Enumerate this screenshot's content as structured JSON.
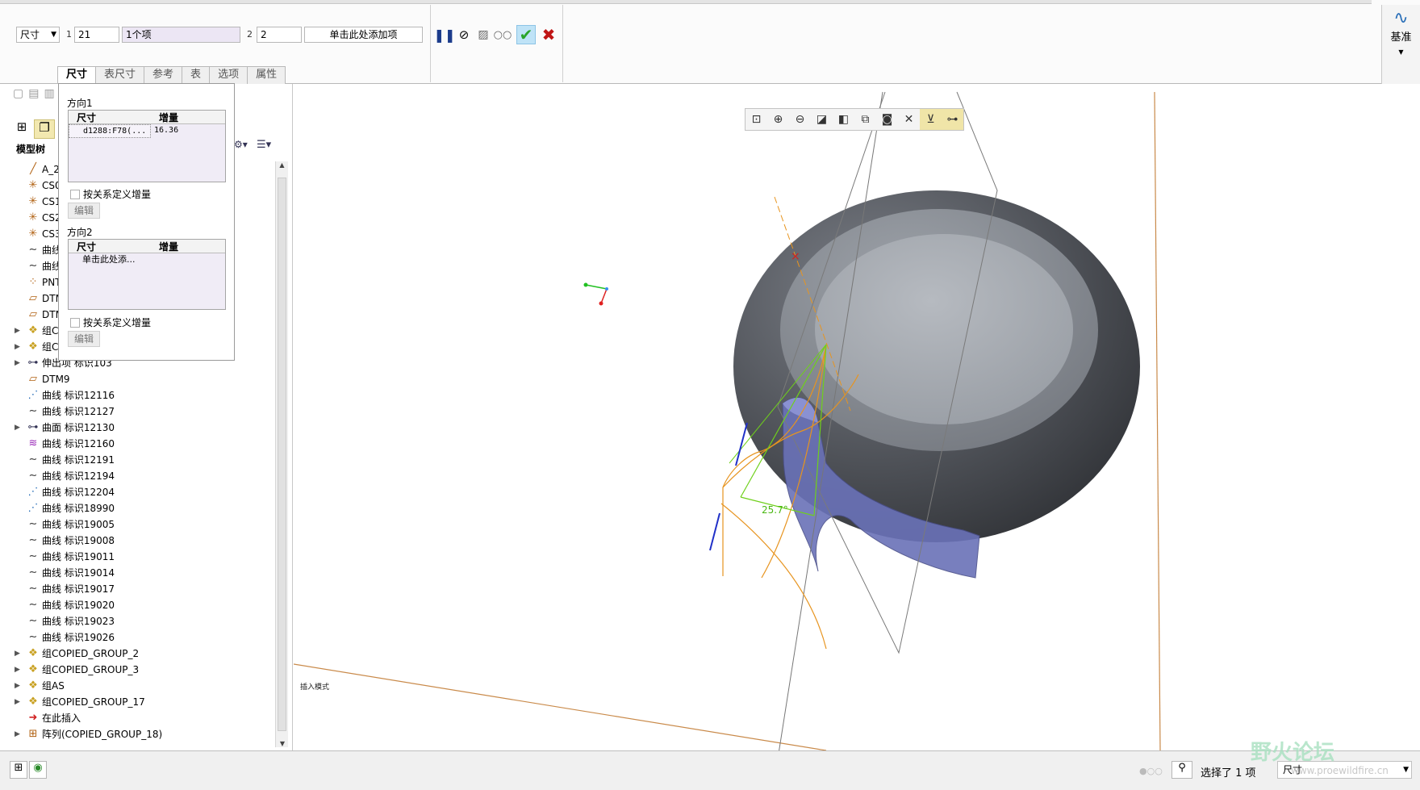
{
  "dashboard": {
    "type_select": "尺寸",
    "dir1_index": "1",
    "dir1_count": "21",
    "dir1_items": "1个项",
    "dir2_index": "2",
    "dir2_count": "2",
    "dir2_items": "单击此处添加项",
    "tabs": [
      "尺寸",
      "表尺寸",
      "参考",
      "表",
      "选项",
      "属性"
    ],
    "datum_label": "基准"
  },
  "dim_panel": {
    "dir1_label": "方向1",
    "dir2_label": "方向2",
    "col_dim": "尺寸",
    "col_inc": "增量",
    "dir1_row_dim": "d1288:F78(...",
    "dir1_row_inc": "16.36",
    "dir2_placeholder": "单击此处添...",
    "relation_check": "按关系定义增量",
    "edit_button": "编辑"
  },
  "tree": {
    "header_label": "模型树",
    "items": [
      {
        "label": "A_2",
        "icon": "axis-icon",
        "expand": false
      },
      {
        "label": "CS0",
        "icon": "csys-icon",
        "expand": false
      },
      {
        "label": "CS1",
        "icon": "csys-icon",
        "expand": false
      },
      {
        "label": "CS2",
        "icon": "csys-icon",
        "expand": false
      },
      {
        "label": "CS3",
        "icon": "csys-icon",
        "expand": false
      },
      {
        "label": "曲线",
        "icon": "curve-icon",
        "expand": false
      },
      {
        "label": "曲线",
        "icon": "curve-icon",
        "expand": false
      },
      {
        "label": "PNT",
        "icon": "point-icon",
        "expand": false
      },
      {
        "label": "DTM",
        "icon": "plane-icon",
        "expand": false
      },
      {
        "label": "DTM",
        "icon": "plane-icon",
        "expand": false
      },
      {
        "label": "组C",
        "icon": "group-icon",
        "expand": true
      },
      {
        "label": "组C",
        "icon": "group-icon",
        "expand": true
      },
      {
        "label": "伸出项 标识103",
        "icon": "protrusion-icon",
        "expand": true
      },
      {
        "label": "DTM9",
        "icon": "plane-icon",
        "expand": false
      },
      {
        "label": "曲线 标识12116",
        "icon": "curve-dotted-icon",
        "expand": false
      },
      {
        "label": "曲线 标识12127",
        "icon": "curve-icon",
        "expand": false
      },
      {
        "label": "曲面 标识12130",
        "icon": "surface-icon",
        "expand": true
      },
      {
        "label": "曲线 标识12160",
        "icon": "curve-purple-icon",
        "expand": false
      },
      {
        "label": "曲线 标识12191",
        "icon": "curve-icon",
        "expand": false
      },
      {
        "label": "曲线 标识12194",
        "icon": "curve-icon",
        "expand": false
      },
      {
        "label": "曲线 标识12204",
        "icon": "curve-dotted-icon",
        "expand": false
      },
      {
        "label": "曲线 标识18990",
        "icon": "curve-dotted-icon",
        "expand": false
      },
      {
        "label": "曲线 标识19005",
        "icon": "curve-icon",
        "expand": false
      },
      {
        "label": "曲线 标识19008",
        "icon": "curve-icon",
        "expand": false
      },
      {
        "label": "曲线 标识19011",
        "icon": "curve-icon",
        "expand": false
      },
      {
        "label": "曲线 标识19014",
        "icon": "curve-icon",
        "expand": false
      },
      {
        "label": "曲线 标识19017",
        "icon": "curve-icon",
        "expand": false
      },
      {
        "label": "曲线 标识19020",
        "icon": "curve-icon",
        "expand": false
      },
      {
        "label": "曲线 标识19023",
        "icon": "curve-icon",
        "expand": false
      },
      {
        "label": "曲线 标识19026",
        "icon": "curve-icon",
        "expand": false
      },
      {
        "label": "组COPIED_GROUP_2",
        "icon": "group-icon",
        "expand": true
      },
      {
        "label": "组COPIED_GROUP_3",
        "icon": "group-icon",
        "expand": true
      },
      {
        "label": "组AS",
        "icon": "group-icon",
        "expand": true
      },
      {
        "label": "组COPIED_GROUP_17",
        "icon": "group-icon",
        "expand": true
      },
      {
        "label": "在此插入",
        "icon": "insert-arrow-icon",
        "expand": false
      },
      {
        "label": "阵列(COPIED_GROUP_18)",
        "icon": "pattern-icon",
        "expand": true
      }
    ]
  },
  "viewport": {
    "angle_label": "25.7°",
    "mode_text": "插入模式"
  },
  "status": {
    "selection_text": "选择了 1 项",
    "filter_value": "尺寸"
  },
  "watermark": {
    "text": "野火论坛",
    "url": "www.proewildfire.cn"
  },
  "colors": {
    "body_dark": "#3c3f44",
    "body_light": "#9ea3aa",
    "blue_surface": "#6a72b8",
    "orange_curve": "#e7941f",
    "green_sketch": "#6fd01b",
    "confirm_green": "#2aa52a",
    "cancel_red": "#c01515"
  }
}
